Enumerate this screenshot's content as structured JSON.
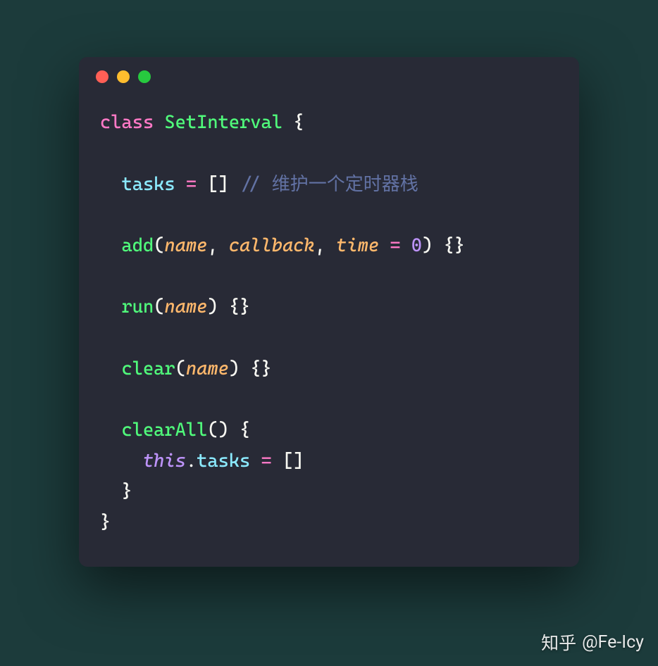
{
  "code": {
    "line1": {
      "keyword": "class",
      "name": "SetInterval",
      "brace": " {"
    },
    "line3": {
      "prop": "tasks",
      "op": " = ",
      "val": "[]",
      "comment": " // 维护一个定时器栈"
    },
    "line5": {
      "method": "add",
      "p1": "name",
      "c1": ", ",
      "p2": "callback",
      "c2": ", ",
      "p3": "time",
      "op": " = ",
      "num": "0",
      "tail": ") {}"
    },
    "line7": {
      "method": "run",
      "p1": "name",
      "tail": ") {}"
    },
    "line9": {
      "method": "clear",
      "p1": "name",
      "tail": ") {}"
    },
    "line11": {
      "method": "clearAll",
      "tail": "() {"
    },
    "line12": {
      "this": "this",
      "dot": ".",
      "prop": "tasks",
      "op": " = ",
      "val": "[]"
    },
    "line13": {
      "brace": "}"
    },
    "line14": {
      "brace": "}"
    }
  },
  "attribution": {
    "platform": "知乎",
    "author": "@Fe-Icy"
  }
}
